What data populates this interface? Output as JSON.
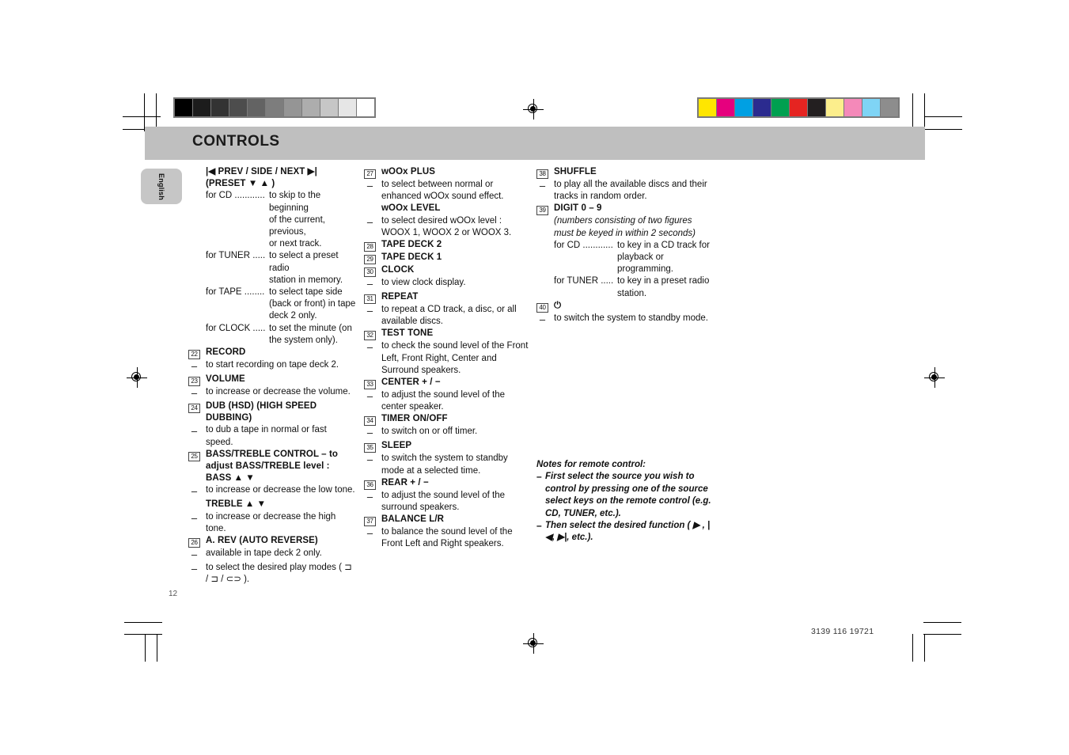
{
  "header": {
    "title": "CONTROLS",
    "language_tab": "English"
  },
  "print_marks": {
    "grayscale_swatches": [
      "#000000",
      "#1c1c1c",
      "#333333",
      "#4d4d4d",
      "#636363",
      "#7d7d7d",
      "#959595",
      "#adadad",
      "#c6c6c6",
      "#e6e6e6",
      "#ffffff"
    ],
    "color_swatches": [
      "#ffe600",
      "#e6007e",
      "#00a0e3",
      "#2b2b8f",
      "#00a050",
      "#e52421",
      "#231f20",
      "#fcee8c",
      "#f489b9",
      "#7fd4f5",
      "#8d8d8d"
    ]
  },
  "columns": {
    "col1": [
      {
        "type": "heading_plain",
        "bold_lines": [
          "|◀ PREV / SIDE / NEXT ▶|",
          "(PRESET ▼ ▲ )"
        ],
        "defs": [
          {
            "label": "for CD ............",
            "lines": [
              "to skip to the beginning",
              "of the current, previous,",
              "or next track."
            ]
          },
          {
            "label": "for TUNER .....",
            "lines": [
              "to select a preset radio",
              "station in memory."
            ]
          },
          {
            "label": "for TAPE ........",
            "lines": [
              "to select tape side",
              "(back or front) in tape",
              "deck 2 only."
            ]
          },
          {
            "label": "for CLOCK .....",
            "lines": [
              "to set the minute (on",
              "the system only)."
            ]
          }
        ]
      },
      {
        "type": "item",
        "num": "22",
        "title": "RECORD",
        "bullets": [
          "to start recording on tape deck 2."
        ]
      },
      {
        "type": "item",
        "num": "23",
        "title": "VOLUME",
        "bullets": [
          "to increase or decrease the volume."
        ]
      },
      {
        "type": "item",
        "num": "24",
        "title": "DUB (HSD) (HIGH SPEED DUBBING)",
        "bullets": [
          "to dub a tape in normal or fast speed."
        ]
      },
      {
        "type": "item",
        "num": "25",
        "title": "BASS/TREBLE CONTROL – to adjust BASS/TREBLE level :",
        "sub": "BASS ▲ ▼",
        "bullets": [
          "to increase or decrease the low tone."
        ],
        "sub2": "TREBLE ▲ ▼",
        "bullets2": [
          "to increase or decrease the high tone."
        ]
      },
      {
        "type": "item",
        "num": "26",
        "title": "A. REV (AUTO REVERSE)",
        "bullets": [
          "available in tape deck 2 only.",
          "to select the desired play modes ( ⊐ / ⊐ / ⊂⊃ )."
        ]
      }
    ],
    "col2": [
      {
        "type": "item",
        "num": "27",
        "title": "wOOx PLUS",
        "bullets": [
          "to select between normal or enhanced wOOx sound effect."
        ],
        "sub": "wOOx LEVEL",
        "bullets2": [
          "to select desired wOOx level : WOOX 1, WOOX 2 or WOOX 3."
        ]
      },
      {
        "type": "item",
        "num": "28",
        "title": "TAPE DECK 2",
        "bullets": []
      },
      {
        "type": "item",
        "num": "29",
        "title": "TAPE DECK 1",
        "bullets": []
      },
      {
        "type": "item",
        "num": "30",
        "title": "CLOCK",
        "bullets": [
          "to view clock display."
        ]
      },
      {
        "type": "item",
        "num": "31",
        "title": "REPEAT",
        "bullets": [
          "to repeat a CD track, a disc, or all available discs."
        ]
      },
      {
        "type": "item",
        "num": "32",
        "title": "TEST TONE",
        "bullets": [
          "to check the sound level of the Front Left, Front Right, Center and Surround speakers."
        ]
      },
      {
        "type": "item",
        "num": "33",
        "title": "CENTER + / −",
        "bullets": [
          "to adjust the sound level of the center speaker."
        ]
      },
      {
        "type": "item",
        "num": "34",
        "title": "TIMER ON/OFF",
        "bullets": [
          "to switch on or off timer."
        ]
      },
      {
        "type": "item",
        "num": "35",
        "title": "SLEEP",
        "bullets": [
          "to switch the system to standby mode at a selected time."
        ]
      },
      {
        "type": "item",
        "num": "36",
        "title": "REAR + / −",
        "bullets": [
          "to adjust the sound level of the surround speakers."
        ]
      },
      {
        "type": "item",
        "num": "37",
        "title": "BALANCE L/R",
        "bullets": [
          "to balance the sound level of the Front Left and Right speakers."
        ]
      }
    ],
    "col3": [
      {
        "type": "item",
        "num": "38",
        "title": "SHUFFLE",
        "bullets": [
          "to play all the available discs and their tracks in random order."
        ]
      },
      {
        "type": "item_defs",
        "num": "39",
        "title": "DIGIT  0 – 9",
        "italic_lines": [
          "(numbers consisting of two figures",
          "must be keyed in within 2 seconds)"
        ],
        "defs": [
          {
            "label": "for CD ............",
            "lines": [
              "to key in a CD track for",
              "playback or",
              "programming."
            ]
          },
          {
            "label": "for TUNER .....",
            "lines": [
              "to key in a preset radio",
              "station."
            ]
          }
        ]
      },
      {
        "type": "item",
        "num": "40",
        "title": "⏻",
        "bullets": [
          "to switch the system to standby mode."
        ]
      }
    ]
  },
  "notes": {
    "heading": "Notes for remote control:",
    "items": [
      "First select the source you wish to control by pressing one of the source select keys on the remote control (e.g.  CD, TUNER, etc.).",
      "Then select the desired function ( ▶ ,  |◀,  ▶|,  etc.)."
    ]
  },
  "footer": {
    "page_number": "12",
    "document_number": "3139 116 19721"
  }
}
